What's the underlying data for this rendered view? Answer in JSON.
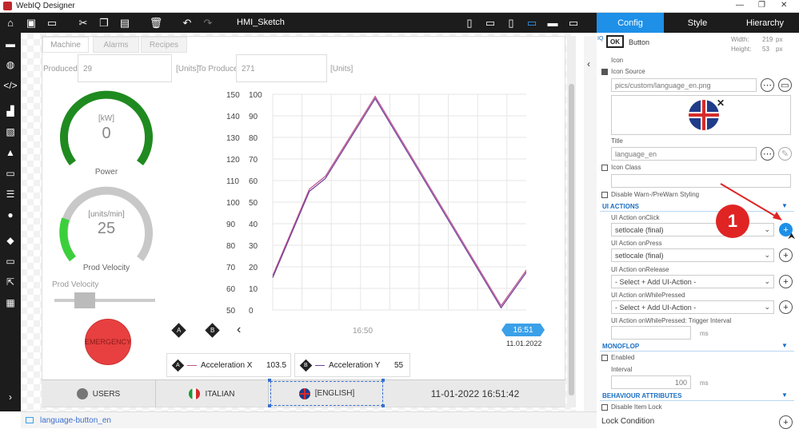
{
  "window": {
    "title": "WebIQ Designer"
  },
  "toolbar": {
    "sketch_title": "HMI_Sketch"
  },
  "panel_tabs": [
    "Config",
    "Style",
    "Hierarchy"
  ],
  "hmi": {
    "tabs": [
      "Machine",
      "Alarms",
      "Recipes"
    ],
    "produced_label": "Produced",
    "produced_value": "29",
    "units_label_1": "[Units]",
    "to_produce_label": "To Produce",
    "to_produce_value": "271",
    "units_label_2": "[Units]",
    "power_unit": "[kW]",
    "power_value": "0",
    "power_label": "Power",
    "velocity_unit": "[units/min]",
    "velocity_value": "25",
    "velocity_label": "Prod Velocity",
    "slider_label": "Prod Velocity",
    "slider_value": 0.2,
    "emergency_label": "EMERGENCY",
    "emergency_color": "#e84040",
    "power_color": "#1f8a1f",
    "velocity_color": "#3ccf3c",
    "legend": [
      {
        "badge": "A",
        "name": "Acceleration X",
        "value": "103.5"
      },
      {
        "badge": "B",
        "name": "Acceleration Y",
        "value": "55"
      }
    ],
    "nav_prev": "‹",
    "time_label": "16:50",
    "cursor_time": "16:51",
    "cursor_date": "11.01.2022",
    "bottom": {
      "users": "USERS",
      "italian": "ITALIAN",
      "english": "[ENGLISH]",
      "datetime": "11-01-2022 16:51:42"
    }
  },
  "chart_data": {
    "type": "line",
    "y_left_ticks": [
      "150",
      "140",
      "130",
      "120",
      "110",
      "100",
      "90",
      "80",
      "70",
      "60",
      "50"
    ],
    "y_right_ticks": [
      "100",
      "90",
      "80",
      "70",
      "60",
      "50",
      "40",
      "30",
      "20",
      "10",
      "0"
    ],
    "ylim_left": [
      50,
      150
    ],
    "ylim_right": [
      0,
      100
    ],
    "series": [
      {
        "badge": "A",
        "color": "#c0508a",
        "x": [
          0,
          0.125,
          0.18,
          0.35,
          0.78,
          1
        ],
        "y": [
          66,
          106,
          112,
          149,
          52,
          94
        ]
      },
      {
        "badge": "B",
        "color": "#6a3d9a",
        "x": [
          0,
          0.125,
          0.18,
          0.35,
          0.78,
          1
        ],
        "y": [
          65,
          105,
          111,
          148,
          51,
          93
        ]
      }
    ]
  },
  "panel": {
    "icon_badge": "OK",
    "widget_type": "Button",
    "width_label": "Width:",
    "width_value": "219",
    "height_label": "Height:",
    "height_value": "53",
    "unit_px": "px",
    "icon_label": "Icon",
    "icon_source_label": "Icon Source",
    "icon_source_value": "pics/custom/language_en.png",
    "title_label": "Title",
    "title_value": "language_en",
    "icon_class_label": "Icon Class",
    "disable_warn_label": "Disable Warn-/PreWarn Styling",
    "ui_actions_title": "UI ACTIONS",
    "onclick_label": "UI Action onClick",
    "onclick_value": "setlocale (final)",
    "onpress_label": "UI Action onPress",
    "onpress_value": "setlocale (final)",
    "onrelease_label": "UI Action onRelease",
    "onrelease_value": "- Select + Add UI-Action -",
    "onwhile_label": "UI Action onWhilePressed",
    "onwhile_value": "- Select + Add UI-Action -",
    "trigger_label": "UI Action onWhilePressed: Trigger Interval",
    "ms": "ms",
    "monoflop_title": "MONOFLOP",
    "enabled_label": "Enabled",
    "interval_label": "Interval",
    "interval_value": "100",
    "behaviour_title": "BEHAVIOUR ATTRIBUTES",
    "disable_lock_label": "Disable Item Lock",
    "lock_condition_label": "Lock Condition",
    "callout_number": "1"
  },
  "status": {
    "selected": "language-button_en"
  }
}
